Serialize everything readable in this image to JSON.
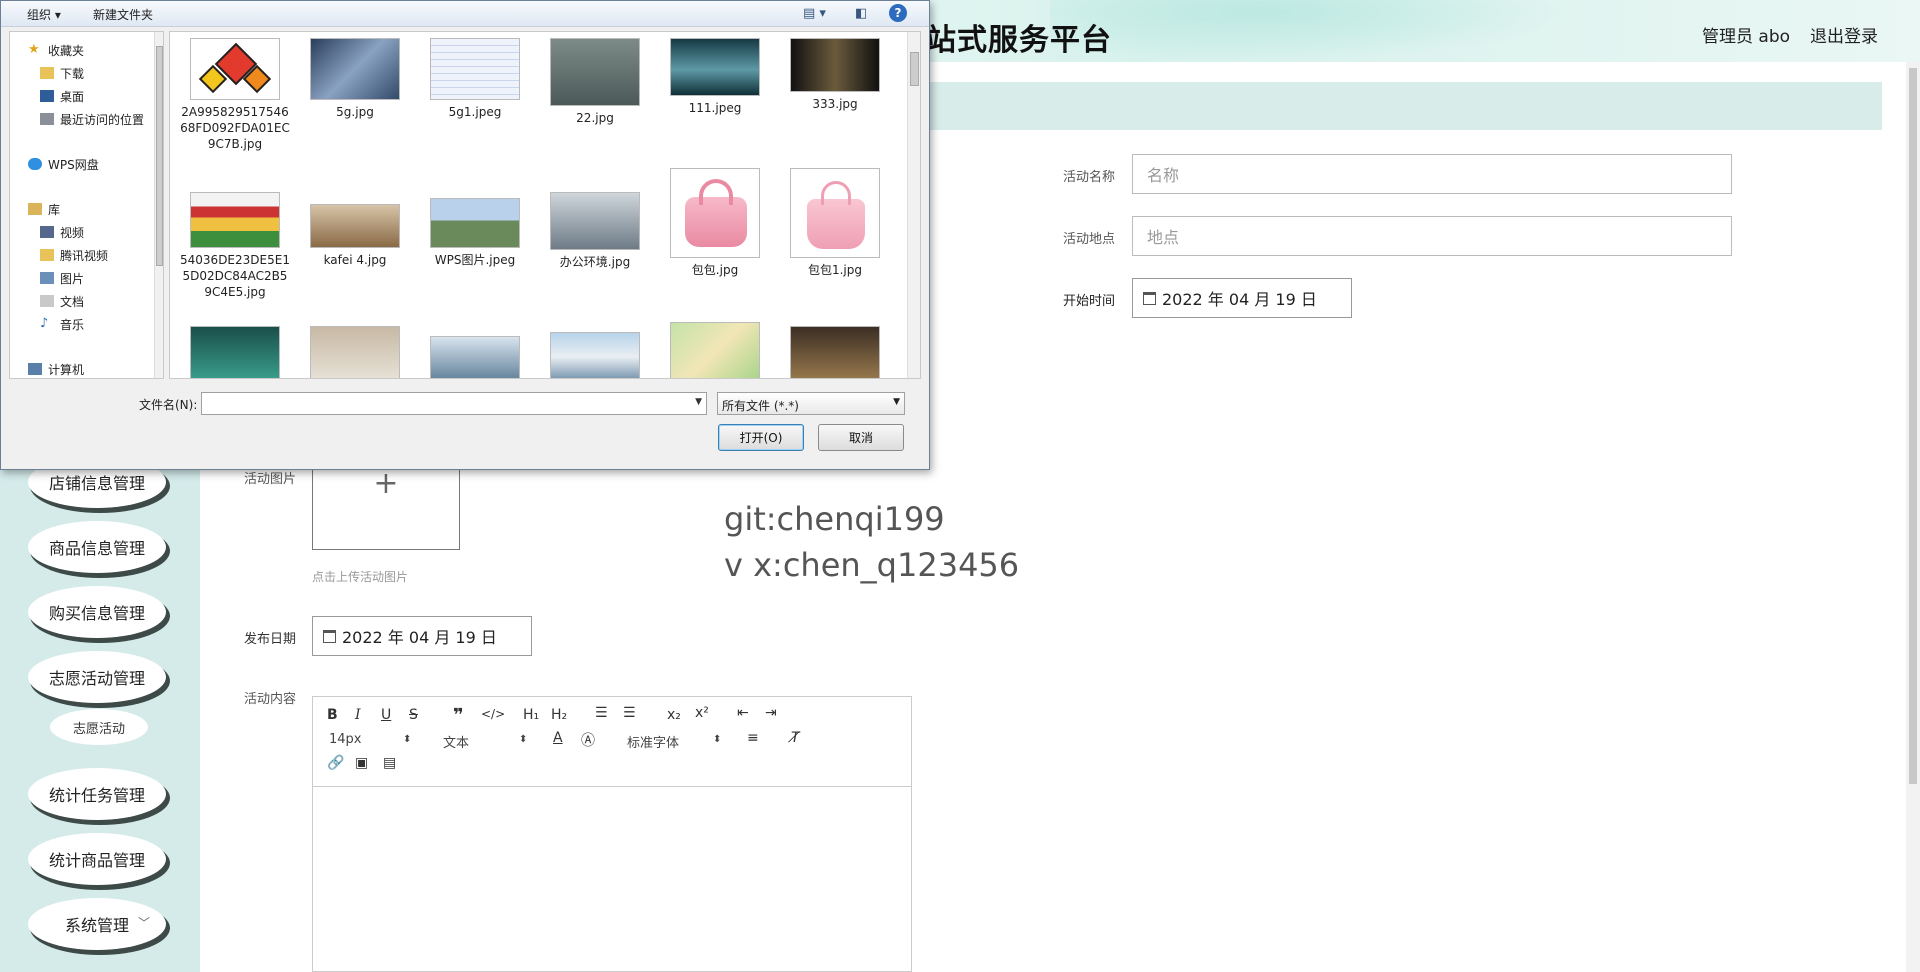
{
  "app": {
    "title": "站式服务平台",
    "user": "管理员 abo",
    "logout": "退出登录"
  },
  "sidebar": {
    "items": [
      {
        "label": "店铺信息管理"
      },
      {
        "label": "商品信息管理"
      },
      {
        "label": "购买信息管理"
      },
      {
        "label": "志愿活动管理"
      },
      {
        "label": "志愿活动"
      },
      {
        "label": "统计任务管理"
      },
      {
        "label": "统计商品管理"
      },
      {
        "label": "系统管理"
      }
    ]
  },
  "form": {
    "name_label": "活动名称",
    "name_placeholder": "名称",
    "location_label": "活动地点",
    "location_placeholder": "地点",
    "start_label": "开始时间",
    "start_value": "2022 年 04 月 19 日",
    "image_label": "活动图片",
    "upload_plus": "+",
    "upload_hint": "点击上传活动图片",
    "publish_label": "发布日期",
    "publish_value": "2022 年 04 月 19 日",
    "content_label": "活动内容"
  },
  "watermark": {
    "line1": "git:chenqi199",
    "line2": "v x:chen_q123456"
  },
  "editor": {
    "font_size": "14px",
    "block_type": "文本",
    "font_family": "标准字体"
  },
  "dialog": {
    "toolbar": {
      "organize": "组织 ▾",
      "new_folder": "新建文件夹"
    },
    "nav": [
      {
        "label": "收藏夹"
      },
      {
        "label": "下载"
      },
      {
        "label": "桌面"
      },
      {
        "label": "最近访问的位置"
      },
      {
        "label": "WPS网盘"
      },
      {
        "label": "库"
      },
      {
        "label": "视频"
      },
      {
        "label": "腾讯视频"
      },
      {
        "label": "图片"
      },
      {
        "label": "文档"
      },
      {
        "label": "音乐"
      },
      {
        "label": "计算机"
      }
    ],
    "files": [
      {
        "name": "2A99582951754668FD092FDA01EC9C7B.jpg"
      },
      {
        "name": "5g.jpg"
      },
      {
        "name": "5g1.jpeg"
      },
      {
        "name": "22.jpg"
      },
      {
        "name": "111.jpeg"
      },
      {
        "name": "333.jpg"
      },
      {
        "name": "54036DE23DE5E15D02DC84AC2B59C4E5.jpg"
      },
      {
        "name": "kafei 4.jpg"
      },
      {
        "name": "WPS图片.jpeg"
      },
      {
        "name": "办公环境.jpg"
      },
      {
        "name": "包包.jpg"
      },
      {
        "name": "包包1.jpg"
      }
    ],
    "filename_label": "文件名(N):",
    "filename_value": "",
    "filetype": "所有文件 (*.*)",
    "open_button": "打开(O)",
    "cancel_button": "取消"
  }
}
